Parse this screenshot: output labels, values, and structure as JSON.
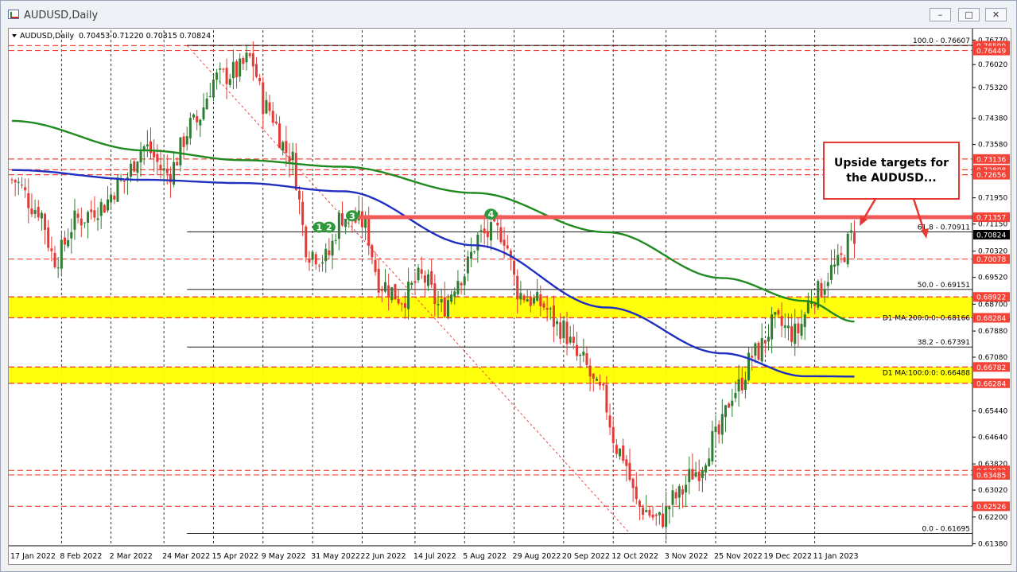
{
  "window": {
    "title": "AUDUSD,Daily"
  },
  "symbol_line": {
    "symbol": "AUDUSD,Daily",
    "ohlc": "0.70453 0.71220 0.70315 0.70824"
  },
  "annotation": {
    "line1": "Upside targets for",
    "line2": "the AUDUSD..."
  },
  "colors": {
    "up": "#2e7d32",
    "down": "#e53935",
    "ma100": "#1f2fbf",
    "ma200": "#1f8a1f",
    "zone": "#ffff00",
    "level": "#f44336",
    "resistance": "#f25a5a"
  },
  "chart_data": {
    "type": "candlestick",
    "ylim": [
      0.6132,
      0.7707
    ],
    "x_ticks": [
      "17 Jan 2022",
      "8 Feb 2022",
      "2 Mar 2022",
      "24 Mar 2022",
      "15 Apr 2022",
      "9 May 2022",
      "31 May 2022",
      "22 Jun 2022",
      "14 Jul 2022",
      "5 Aug 2022",
      "29 Aug 2022",
      "20 Sep 2022",
      "12 Oct 2022",
      "3 Nov 2022",
      "25 Nov 2022",
      "19 Dec 2022",
      "11 Jan 2023"
    ],
    "y_ticks": [
      0.7677,
      0.7602,
      0.7532,
      0.7438,
      0.7358,
      0.7195,
      0.7115,
      0.7032,
      0.6952,
      0.687,
      0.6788,
      0.6708,
      0.6544,
      0.6464,
      0.6382,
      0.6302,
      0.622,
      0.6138
    ],
    "price_labels": [
      {
        "label": "0.76599",
        "value": 0.76599,
        "color": "#f44336"
      },
      {
        "label": "0.76449",
        "value": 0.76449,
        "color": "#f44336"
      },
      {
        "label": "0.73136",
        "value": 0.73136,
        "color": "#f44336"
      },
      {
        "label": "0.72808",
        "value": 0.72808,
        "color": "#f44336"
      },
      {
        "label": "0.72656",
        "value": 0.72656,
        "color": "#f44336"
      },
      {
        "label": "0.71357",
        "value": 0.71357,
        "color": "#f44336"
      },
      {
        "label": "0.70824",
        "value": 0.70824,
        "color": "#000000"
      },
      {
        "label": "0.70078",
        "value": 0.70078,
        "color": "#f44336"
      },
      {
        "label": "0.68922",
        "value": 0.68922,
        "color": "#f44336"
      },
      {
        "label": "0.68284",
        "value": 0.68284,
        "color": "#f44336"
      },
      {
        "label": "0.66782",
        "value": 0.66782,
        "color": "#f44336"
      },
      {
        "label": "0.66284",
        "value": 0.66284,
        "color": "#f44336"
      },
      {
        "label": "0.63622",
        "value": 0.63622,
        "color": "#f44336"
      },
      {
        "label": "0.63485",
        "value": 0.63485,
        "color": "#f44336"
      },
      {
        "label": "0.62526",
        "value": 0.62526,
        "color": "#f44336"
      }
    ],
    "dashed_levels": [
      0.76599,
      0.76449,
      0.73136,
      0.72808,
      0.72656,
      0.70078,
      0.63622,
      0.63485,
      0.62526
    ],
    "zones": [
      {
        "low": 0.68284,
        "high": 0.68922
      },
      {
        "low": 0.66284,
        "high": 0.66782
      }
    ],
    "resistance": {
      "value": 0.71357,
      "from": "31 May 2022"
    },
    "fibonacci": [
      {
        "label": "100.0 - 0.76607",
        "value": 0.76607
      },
      {
        "label": "61.8 - 0.70911",
        "value": 0.70911
      },
      {
        "label": "50.0 - 0.69151",
        "value": 0.69151
      },
      {
        "label": "38.2 - 0.67391",
        "value": 0.67391
      },
      {
        "label": "0.0 - 0.61695",
        "value": 0.61695
      }
    ],
    "ma_labels": [
      {
        "label": "D1 MA:200:0:0: 0.68166",
        "value": 0.68166
      },
      {
        "label": "D1 MA:100:0:0: 0.66488",
        "value": 0.66488
      }
    ],
    "markers": [
      {
        "label": "1",
        "date_index": 93,
        "value": 0.7105
      },
      {
        "label": "2",
        "date_index": 96,
        "value": 0.7105
      },
      {
        "label": "3",
        "date_index": 103,
        "value": 0.714
      },
      {
        "label": "4",
        "date_index": 145,
        "value": 0.7145
      }
    ],
    "ohlc_anchors": [
      [
        0,
        0.725
      ],
      [
        8,
        0.716
      ],
      [
        13,
        0.701
      ],
      [
        20,
        0.713
      ],
      [
        27,
        0.717
      ],
      [
        33,
        0.724
      ],
      [
        40,
        0.735
      ],
      [
        47,
        0.727
      ],
      [
        55,
        0.742
      ],
      [
        62,
        0.756
      ],
      [
        68,
        0.758
      ],
      [
        72,
        0.762
      ],
      [
        77,
        0.747
      ],
      [
        84,
        0.733
      ],
      [
        90,
        0.703
      ],
      [
        95,
        0.701
      ],
      [
        100,
        0.714
      ],
      [
        106,
        0.712
      ],
      [
        112,
        0.693
      ],
      [
        118,
        0.689
      ],
      [
        124,
        0.695
      ],
      [
        130,
        0.686
      ],
      [
        136,
        0.696
      ],
      [
        142,
        0.708
      ],
      [
        148,
        0.709
      ],
      [
        154,
        0.69
      ],
      [
        160,
        0.687
      ],
      [
        166,
        0.68
      ],
      [
        172,
        0.67
      ],
      [
        178,
        0.66
      ],
      [
        184,
        0.642
      ],
      [
        190,
        0.625
      ],
      [
        196,
        0.621
      ],
      [
        201,
        0.628
      ],
      [
        207,
        0.636
      ],
      [
        213,
        0.646
      ],
      [
        219,
        0.661
      ],
      [
        225,
        0.672
      ],
      [
        231,
        0.681
      ],
      [
        237,
        0.678
      ],
      [
        243,
        0.69
      ],
      [
        249,
        0.698
      ],
      [
        255,
        0.7082
      ]
    ],
    "ma200_anchors": [
      [
        0,
        0.743
      ],
      [
        40,
        0.734
      ],
      [
        70,
        0.731
      ],
      [
        100,
        0.729
      ],
      [
        140,
        0.721
      ],
      [
        180,
        0.709
      ],
      [
        215,
        0.695
      ],
      [
        240,
        0.688
      ],
      [
        255,
        0.6817
      ]
    ],
    "ma100_anchors": [
      [
        0,
        0.728
      ],
      [
        40,
        0.725
      ],
      [
        70,
        0.724
      ],
      [
        100,
        0.7215
      ],
      [
        140,
        0.705
      ],
      [
        180,
        0.686
      ],
      [
        215,
        0.672
      ],
      [
        240,
        0.665
      ],
      [
        255,
        0.6649
      ]
    ]
  }
}
